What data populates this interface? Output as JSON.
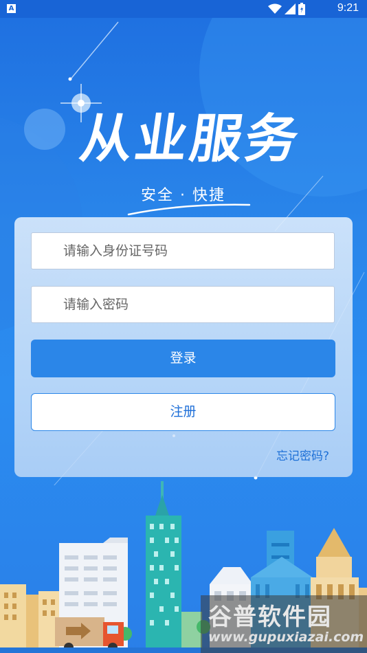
{
  "status_bar": {
    "time": "9:21",
    "notification_icon": "A"
  },
  "hero": {
    "title": "从业服务",
    "subtitle": "安全 · 快捷"
  },
  "login_form": {
    "id_placeholder": "请输入身份证号码",
    "password_placeholder": "请输入密码",
    "login_label": "登录",
    "register_label": "注册",
    "forgot_label": "忘记密码?"
  },
  "watermark": {
    "title": "谷普软件园",
    "url": "www.gupuxiazai.com"
  },
  "colors": {
    "primary": "#2b86e8",
    "background_top": "#1e6fe0",
    "background_bottom": "#2a7fe8"
  }
}
